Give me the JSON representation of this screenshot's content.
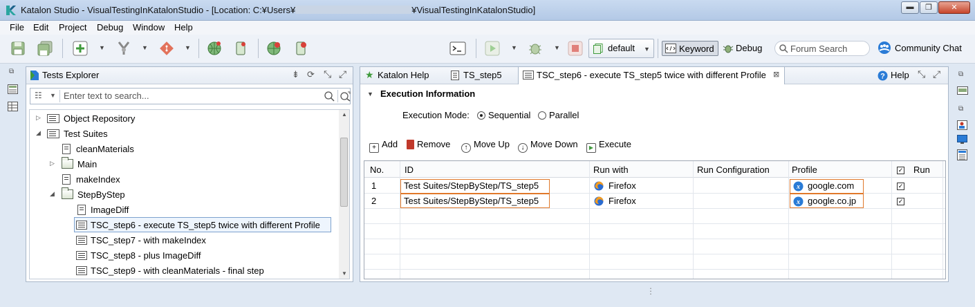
{
  "window": {
    "title": "Katalon Studio - VisualTestingInKatalonStudio - [Location: C:¥Users¥",
    "title_suffix": "¥VisualTestingInKatalonStudio]",
    "min": "▬",
    "max": "❐",
    "close": "✕"
  },
  "menu": [
    "File",
    "Edit",
    "Project",
    "Debug",
    "Window",
    "Help"
  ],
  "toolbar": {
    "profile_label": "default",
    "keyword_label": "Keyword",
    "debug_label": "Debug",
    "search_placeholder": "Forum Search",
    "community_chat": "Community Chat"
  },
  "explorer": {
    "tab_label": "Tests Explorer",
    "search_placeholder": "Enter text to search...",
    "items": {
      "object_repository": "Object Repository",
      "test_suites": "Test Suites",
      "clean_materials": "cleanMaterials",
      "main": "Main",
      "make_index": "makeIndex",
      "step_by_step": "StepByStep",
      "image_diff": "ImageDiff",
      "tsc_step6": "TSC_step6 - execute TS_step5 twice with different Profile",
      "tsc_step7": "TSC_step7 - with makeIndex",
      "tsc_step8": "TSC_step8 - plus ImageDiff",
      "tsc_step9": "TSC_step9 - with cleanMaterials - final step"
    }
  },
  "editor": {
    "tabs": {
      "katalon_help": "Katalon Help",
      "ts_step5": "TS_step5",
      "tsc_step6": "TSC_step6 - execute TS_step5 twice with different Profile"
    },
    "help_label": "Help",
    "section_title": "Execution Information",
    "execution_mode_label": "Execution Mode:",
    "mode_sequential": "Sequential",
    "mode_parallel": "Parallel",
    "selected_mode": "Sequential",
    "actions": {
      "add": "Add",
      "remove": "Remove",
      "move_up": "Move Up",
      "move_down": "Move Down",
      "execute": "Execute"
    },
    "table": {
      "headers": {
        "no": "No.",
        "id": "ID",
        "run_with": "Run with",
        "run_configuration": "Run Configuration",
        "profile": "Profile",
        "run": "Run"
      },
      "rows": [
        {
          "no": "1",
          "id": "Test Suites/StepByStep/TS_step5",
          "run_with": "Firefox",
          "run_configuration": "",
          "profile": "google.com",
          "run": true
        },
        {
          "no": "2",
          "id": "Test Suites/StepByStep/TS_step5",
          "run_with": "Firefox",
          "run_configuration": "",
          "profile": "google.co.jp",
          "run": true
        }
      ]
    }
  },
  "colors": {
    "highlight_border": "#e0782a",
    "selection_bg": "#eef5fd",
    "brand_green": "#3f9a3c"
  }
}
